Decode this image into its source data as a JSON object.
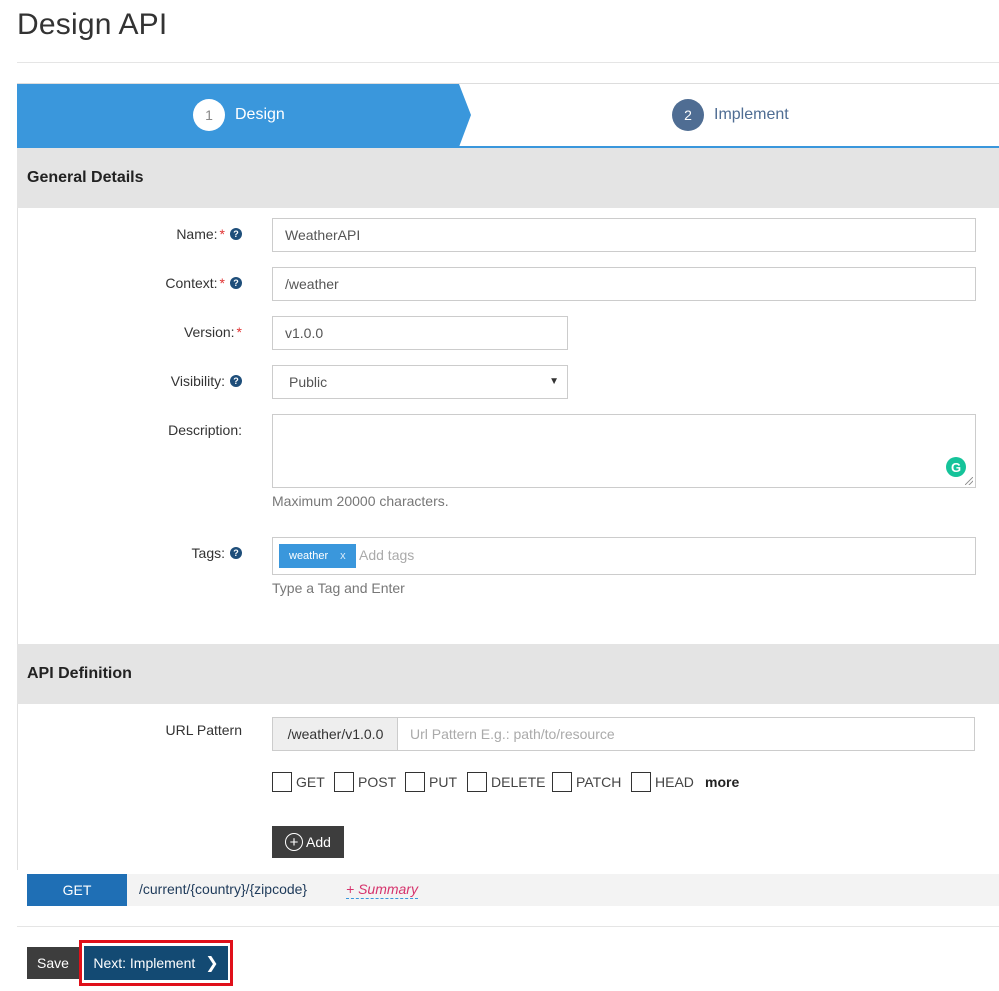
{
  "page": {
    "title": "Design API"
  },
  "wizard": {
    "steps": [
      {
        "number": "1",
        "label": "Design",
        "active": true
      },
      {
        "number": "2",
        "label": "Implement",
        "active": false
      }
    ]
  },
  "general": {
    "heading": "General Details",
    "name": {
      "label": "Name:",
      "value": "WeatherAPI"
    },
    "context": {
      "label": "Context:",
      "value": "/weather"
    },
    "version": {
      "label": "Version:",
      "value": "v1.0.0"
    },
    "visibility": {
      "label": "Visibility:",
      "value": "Public"
    },
    "description": {
      "label": "Description:",
      "value": "",
      "hint": "Maximum 20000 characters."
    },
    "tags": {
      "label": "Tags:",
      "chips": [
        "weather"
      ],
      "chip_remove": "x",
      "placeholder": "Add tags",
      "hint": "Type a Tag and Enter"
    },
    "required_mark": "*",
    "help_mark": "?"
  },
  "api_definition": {
    "heading": "API Definition",
    "url_pattern": {
      "label": "URL Pattern",
      "prefix": "/weather/v1.0.0",
      "placeholder": "Url Pattern E.g.: path/to/resource"
    },
    "verbs": [
      "GET",
      "POST",
      "PUT",
      "DELETE",
      "PATCH",
      "HEAD"
    ],
    "more_label": "more",
    "add_label": "Add",
    "resources": [
      {
        "method": "GET",
        "path": "/current/{country}/{zipcode}",
        "summary_link": "+ Summary"
      }
    ]
  },
  "actions": {
    "save_label": "Save",
    "next_label": "Next: Implement"
  },
  "colors": {
    "primary": "#3a97dc",
    "dark_button": "#3d3d3d",
    "next_button": "#134a73",
    "highlight": "#e0101a"
  }
}
